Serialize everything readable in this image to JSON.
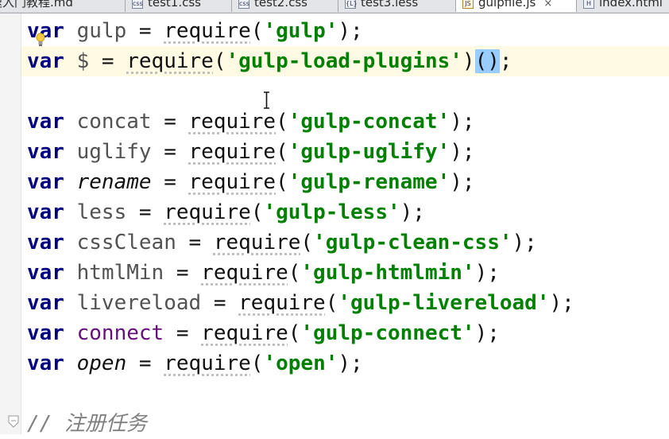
{
  "tabs": [
    {
      "label": "速入门教程.md",
      "icon": "markdown-file-icon",
      "active": false
    },
    {
      "label": "test1.css",
      "icon": "css-file-icon",
      "active": false
    },
    {
      "label": "test2.css",
      "icon": "css-file-icon",
      "active": false
    },
    {
      "label": "test3.less",
      "icon": "less-file-icon",
      "active": false
    },
    {
      "label": "gulpfile.js",
      "icon": "js-file-icon",
      "active": true,
      "close": "×"
    },
    {
      "label": "index.html",
      "icon": "html-file-icon",
      "active": false
    }
  ],
  "code": {
    "line1": {
      "kw": "var",
      "name": "gulp",
      "eq": " = ",
      "fn": "require",
      "open": "(",
      "str": "'gulp'",
      "close": ");"
    },
    "line2": {
      "kw": "var",
      "name": "$",
      "eq": " = ",
      "fn": "require",
      "open": "(",
      "str": "'gulp-load-plugins'",
      "close": ")",
      "call": "()",
      "end": ";"
    },
    "line4": {
      "kw": "var",
      "name": "concat",
      "eq": " = ",
      "fn": "require",
      "open": "(",
      "str": "'gulp-concat'",
      "close": ");"
    },
    "line5": {
      "kw": "var",
      "name": "uglify",
      "eq": " = ",
      "fn": "require",
      "open": "(",
      "str": "'gulp-uglify'",
      "close": ");"
    },
    "line6": {
      "kw": "var",
      "name": "rename",
      "eq": " = ",
      "fn": "require",
      "open": "(",
      "str": "'gulp-rename'",
      "close": ");"
    },
    "line7": {
      "kw": "var",
      "name": "less",
      "eq": " = ",
      "fn": "require",
      "open": "(",
      "str": "'gulp-less'",
      "close": ");"
    },
    "line8": {
      "kw": "var",
      "name": "cssClean",
      "eq": " = ",
      "fn": "require",
      "open": "(",
      "str": "'gulp-clean-css'",
      "close": ");"
    },
    "line9": {
      "kw": "var",
      "name": "htmlMin",
      "eq": " = ",
      "fn": "require",
      "open": "(",
      "str": "'gulp-htmlmin'",
      "close": ");"
    },
    "line10": {
      "kw": "var",
      "name": "livereload",
      "eq": " = ",
      "fn": "require",
      "open": "(",
      "str": "'gulp-livereload'",
      "close": ");"
    },
    "line11": {
      "kw": "var",
      "name": "connect",
      "eq": " = ",
      "fn": "require",
      "open": "(",
      "str": "'gulp-connect'",
      "close": ");"
    },
    "line12": {
      "kw": "var",
      "name": "open",
      "eq": " = ",
      "fn": "require",
      "open": "(",
      "str": "'open'",
      "close": ");"
    },
    "comment": "// 注册任务"
  },
  "colors": {
    "keyword": "#000080",
    "string": "#008000",
    "identifier": "#525252",
    "current_line": "#fffae3",
    "brace_match": "#99ccff",
    "comment": "#808080"
  }
}
